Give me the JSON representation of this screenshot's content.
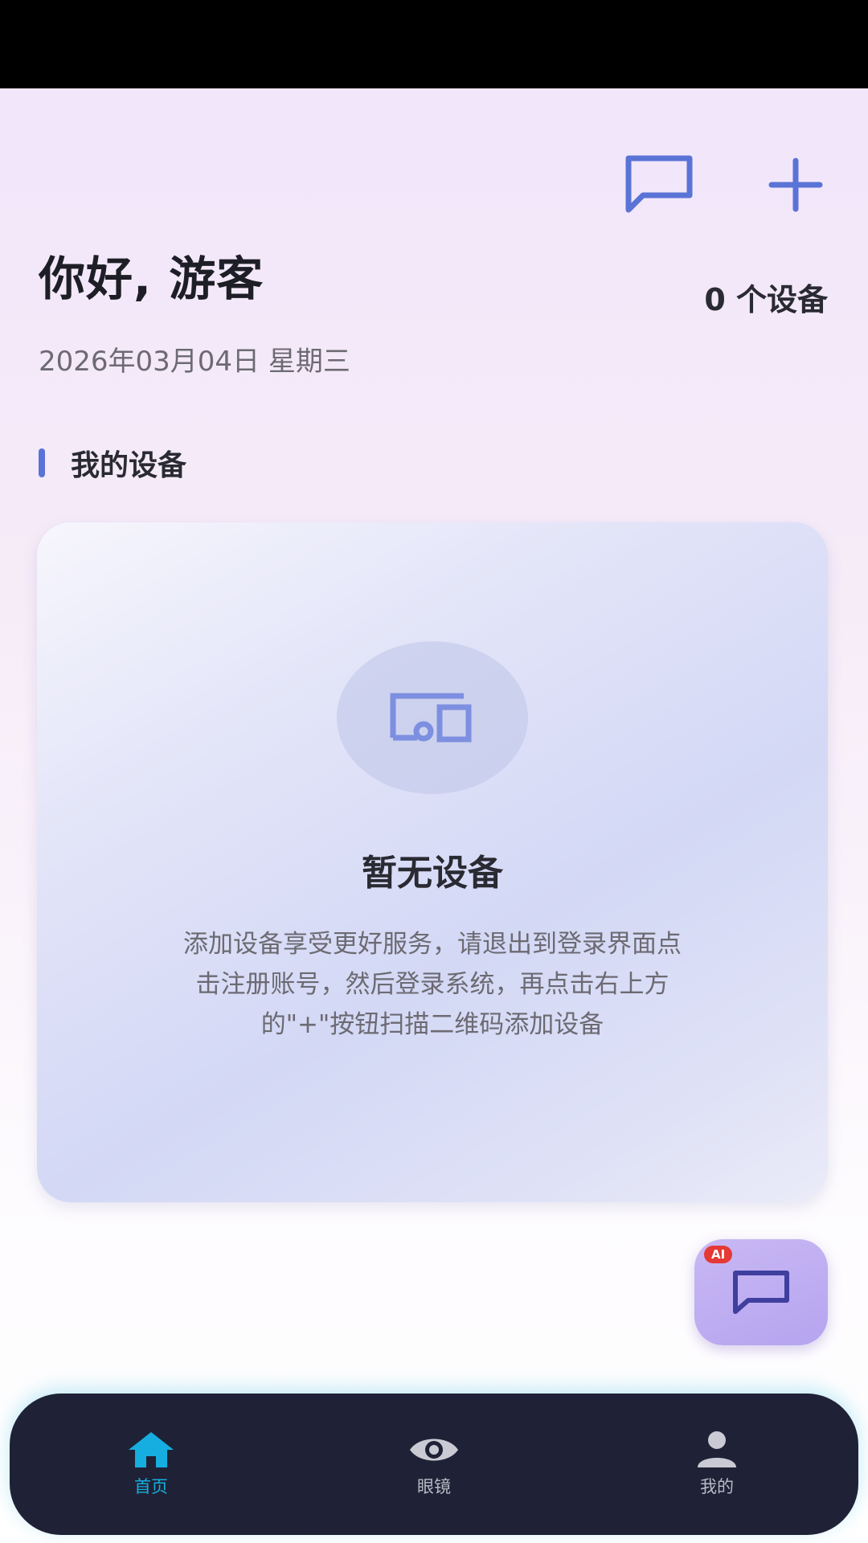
{
  "header": {
    "greeting": "你好, 游客",
    "device_count": "0 个设备",
    "date": "2026年03月04日 星期三",
    "icons": [
      "message-icon",
      "plus-icon"
    ]
  },
  "section": {
    "title": "我的设备"
  },
  "empty_state": {
    "icon": "devices-icon",
    "title": "暂无设备",
    "description": "添加设备享受更好服务，请退出到登录界面点击注册账号，然后登录系统，再点击右上方的\"+\"按钮扫描二维码添加设备"
  },
  "ai_fab": {
    "badge": "AI",
    "icon": "chat-icon"
  },
  "bottom_nav": {
    "items": [
      {
        "label": "首页",
        "icon": "home-icon",
        "active": true
      },
      {
        "label": "眼镜",
        "icon": "eye-icon",
        "active": false
      },
      {
        "label": "我的",
        "icon": "person-icon",
        "active": false
      }
    ]
  },
  "colors": {
    "accent": "#5a73d6",
    "nav_active": "#16aee0",
    "nav_bg": "#1f2236",
    "ai_badge": "#e53935"
  }
}
